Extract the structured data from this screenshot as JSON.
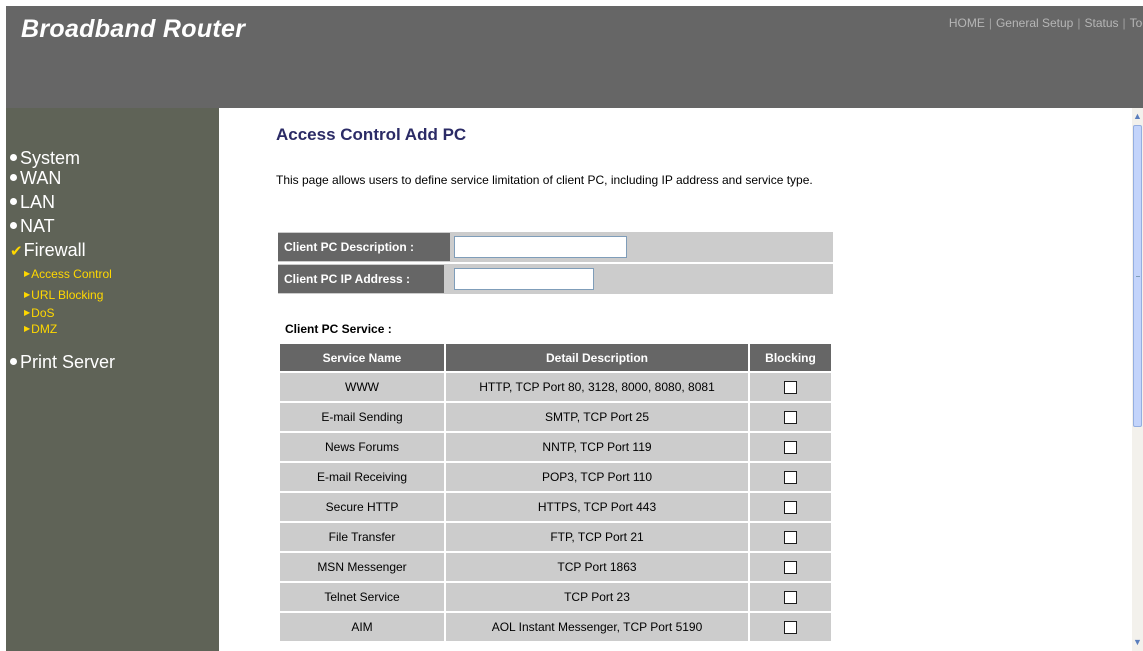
{
  "header": {
    "brand": "Broadband Router",
    "nav": [
      {
        "label": "HOME"
      },
      {
        "label": "General Setup"
      },
      {
        "label": "Status"
      },
      {
        "label": "Too"
      }
    ]
  },
  "sidebar": {
    "items": [
      {
        "label": "System",
        "icon": "bullet"
      },
      {
        "label": "WAN",
        "icon": "bullet"
      },
      {
        "label": "LAN",
        "icon": "bullet"
      },
      {
        "label": "NAT",
        "icon": "bullet"
      },
      {
        "label": "Firewall",
        "icon": "check"
      },
      {
        "label": "Print Server",
        "icon": "bullet"
      }
    ],
    "firewall_sub": [
      {
        "label": "Access Control"
      },
      {
        "label": "URL Blocking"
      },
      {
        "label": "DoS"
      },
      {
        "label": "DMZ"
      }
    ]
  },
  "main": {
    "title": "Access Control Add PC",
    "description": "This page allows users to define service limitation of client PC, including IP address and service type.",
    "form": {
      "description_label": "Client PC Description :",
      "description_value": "",
      "ip_label": "Client PC IP Address :",
      "ip_value": ""
    },
    "service_heading": "Client PC Service :",
    "table": {
      "columns": [
        "Service Name",
        "Detail Description",
        "Blocking"
      ],
      "rows": [
        {
          "name": "WWW",
          "detail": "HTTP, TCP Port 80, 3128, 8000, 8080, 8081",
          "blocked": false
        },
        {
          "name": "E-mail Sending",
          "detail": "SMTP, TCP Port 25",
          "blocked": false
        },
        {
          "name": "News Forums",
          "detail": "NNTP, TCP Port 119",
          "blocked": false
        },
        {
          "name": "E-mail Receiving",
          "detail": "POP3, TCP Port 110",
          "blocked": false
        },
        {
          "name": "Secure HTTP",
          "detail": "HTTPS, TCP Port 443",
          "blocked": false
        },
        {
          "name": "File Transfer",
          "detail": "FTP, TCP Port 21",
          "blocked": false
        },
        {
          "name": "MSN Messenger",
          "detail": "TCP Port 1863",
          "blocked": false
        },
        {
          "name": "Telnet Service",
          "detail": "TCP Port 23",
          "blocked": false
        },
        {
          "name": "AIM",
          "detail": "AOL Instant Messenger, TCP Port 5190",
          "blocked": false
        }
      ]
    }
  },
  "colors": {
    "header_bg": "#666666",
    "sidebar_bg": "#5f6357",
    "submenu_text": "#ffd800",
    "title_text": "#2b2b66",
    "table_header_bg": "#666666",
    "table_cell_bg": "#cccccc"
  }
}
